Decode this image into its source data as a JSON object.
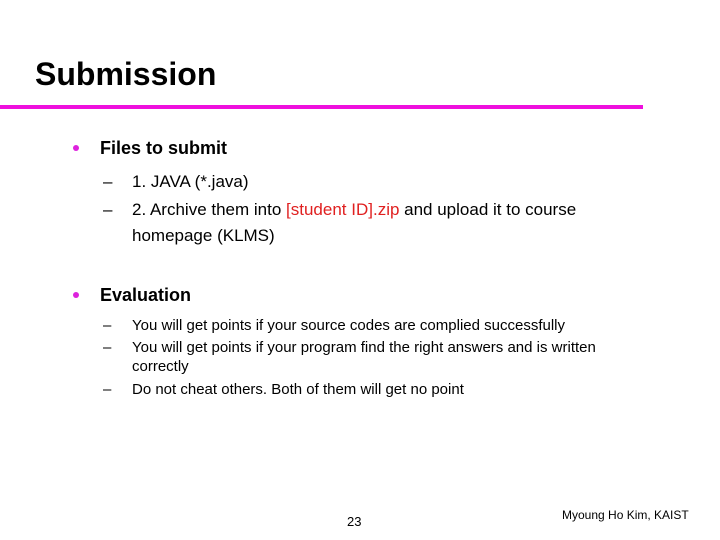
{
  "slide": {
    "title": "Submission",
    "accent_color": "#ee10dd",
    "highlight_color": "#e02020",
    "sections": [
      {
        "heading": "Files to submit",
        "items": [
          {
            "text": "1. JAVA (*.java)"
          },
          {
            "pre": "2. Archive them into ",
            "highlight": "[student ID].zip",
            "post": " and upload it to course",
            "cont": "homepage (KLMS)"
          }
        ]
      },
      {
        "heading": "Evaluation",
        "items": [
          {
            "text": "You will get points if your source codes are complied successfully"
          },
          {
            "text": "You will get points if your program find the right answers and is written",
            "cont": "correctly"
          },
          {
            "text": "Do not cheat others. Both of them will get no point"
          }
        ]
      }
    ],
    "page_number": "23",
    "author": "Myoung Ho Kim, KAIST",
    "dash_glyph": "–"
  }
}
